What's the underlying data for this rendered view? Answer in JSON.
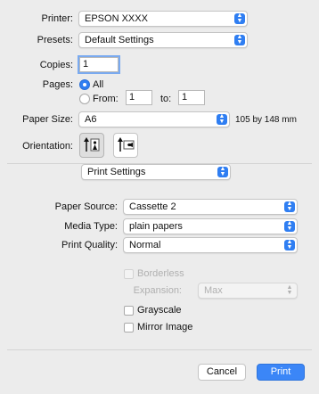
{
  "printer": {
    "label": "Printer:",
    "value": "EPSON XXXX"
  },
  "presets": {
    "label": "Presets:",
    "value": "Default Settings"
  },
  "copies": {
    "label": "Copies:",
    "value": "1"
  },
  "pages": {
    "label": "Pages:",
    "all_label": "All",
    "from_label": "From:",
    "from_value": "1",
    "to_label": "to:",
    "to_value": "1",
    "selected": "All"
  },
  "paper_size": {
    "label": "Paper Size:",
    "value": "A6",
    "dimensions": "105 by 148 mm"
  },
  "orientation": {
    "label": "Orientation:",
    "selected": "portrait"
  },
  "section_menu": {
    "value": "Print Settings"
  },
  "paper_source": {
    "label": "Paper Source:",
    "value": "Cassette 2"
  },
  "media_type": {
    "label": "Media Type:",
    "value": "plain papers"
  },
  "print_quality": {
    "label": "Print Quality:",
    "value": "Normal"
  },
  "borderless": {
    "label": "Borderless",
    "checked": false,
    "enabled": false
  },
  "expansion": {
    "label": "Expansion:",
    "value": "Max",
    "enabled": false
  },
  "grayscale": {
    "label": "Grayscale",
    "checked": false
  },
  "mirror_image": {
    "label": "Mirror Image",
    "checked": false
  },
  "buttons": {
    "cancel": "Cancel",
    "print": "Print"
  },
  "colors": {
    "accent": "#2f7ef2",
    "window_bg": "#ececec",
    "disabled_text": "#b0b0b0"
  }
}
